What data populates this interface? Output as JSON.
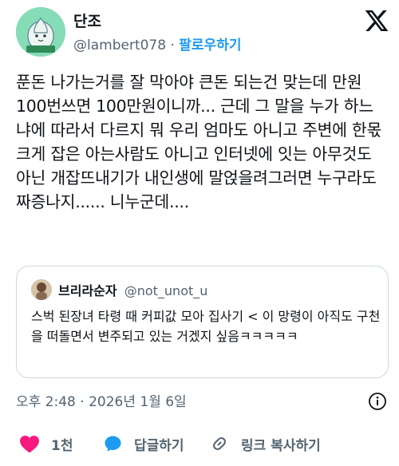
{
  "author": {
    "name": "단조",
    "handle": "@lambert078",
    "separator": "·",
    "follow_label": "팔로우하기"
  },
  "tweet": {
    "text": "푼돈 나가는거를 잘 막아야 큰돈 되는건 맞는데 만원 100번쓰면 100만원이니까... 근데 그 말을 누가 하느냐에 따라서 다르지 뭐 우리 엄마도 아니고 주변에 한몫 크게 잡은 아는사람도 아니고 인터넷에 잇는 아무것도 아닌 개잡뜨내기가 내인생에 말얹을려그러면 누구라도 짜증나지...... 니누군데...."
  },
  "quote": {
    "name": "브리라순자",
    "handle": "@not_unot_u",
    "text": "스벅 된장녀 타령 때 커피값 모아 집사기 < 이 망령이 아직도 구천을 떠돌면서 변주되고 있는 거겠지 싶음ㅋㅋㅋㅋㅋ"
  },
  "meta": {
    "timestamp": "오후 2:48 · 2026년 1월 6일"
  },
  "actions": {
    "like_count": "1천",
    "reply_label": "답글하기",
    "copy_link_label": "링크 복사하기"
  },
  "colors": {
    "accent": "#1d9bf0",
    "like": "#f91880",
    "secondary_text": "#536471",
    "border": "#cfd9de"
  },
  "icons": {
    "brand": "x-logo-icon",
    "info": "info-icon",
    "like": "heart-icon",
    "reply": "reply-bubble-icon",
    "link": "link-icon"
  }
}
